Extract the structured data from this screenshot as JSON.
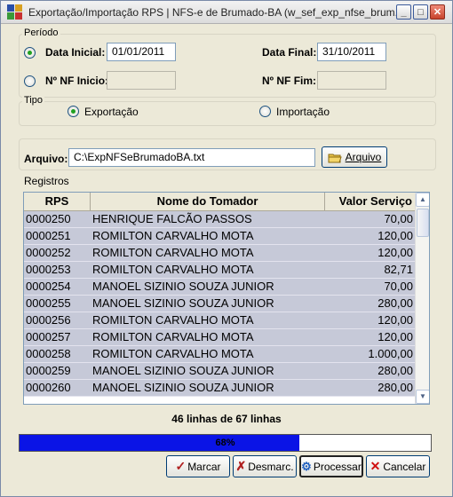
{
  "window": {
    "title": "Exportação/Importação RPS  |  NFS-e de Brumado-BA (w_sef_exp_nfse_brum...",
    "buttons": {
      "minimize": "_",
      "maximize": "□",
      "close": "✕"
    }
  },
  "periodo": {
    "legend": "Período",
    "data_inicial_label": "Data Inicial:",
    "data_inicial_value": "01/01/2011",
    "data_final_label": "Data Final:",
    "data_final_value": "31/10/2011",
    "nf_inicio_label": "Nº NF Inicio:",
    "nf_inicio_value": "",
    "nf_fim_label": "Nº NF Fim:",
    "nf_fim_value": ""
  },
  "tipo": {
    "legend": "Tipo",
    "exportacao_label": "Exportação",
    "importacao_label": "Importação",
    "selected": "Exportação"
  },
  "arquivo": {
    "label": "Arquivo:",
    "value": "C:\\ExpNFSeBrumadoBA.txt",
    "button_label": "Arquivo"
  },
  "registros": {
    "label": "Registros",
    "columns": [
      "RPS",
      "Nome do Tomador",
      "Valor Serviço"
    ],
    "rows": [
      [
        "0000250",
        "HENRIQUE FALCÃO PASSOS",
        "70,00"
      ],
      [
        "0000251",
        "ROMILTON CARVALHO MOTA",
        "120,00"
      ],
      [
        "0000252",
        "ROMILTON CARVALHO MOTA",
        "120,00"
      ],
      [
        "0000253",
        "ROMILTON CARVALHO MOTA",
        "82,71"
      ],
      [
        "0000254",
        "MANOEL SIZINIO SOUZA JUNIOR",
        "70,00"
      ],
      [
        "0000255",
        "MANOEL SIZINIO SOUZA JUNIOR",
        "280,00"
      ],
      [
        "0000256",
        "ROMILTON CARVALHO MOTA",
        "120,00"
      ],
      [
        "0000257",
        "ROMILTON CARVALHO MOTA",
        "120,00"
      ],
      [
        "0000258",
        "ROMILTON CARVALHO MOTA",
        "1.000,00"
      ],
      [
        "0000259",
        "MANOEL SIZINIO SOUZA JUNIOR",
        "280,00"
      ],
      [
        "0000260",
        "MANOEL SIZINIO SOUZA JUNIOR",
        "280,00"
      ]
    ],
    "status": "46 linhas de 67 linhas"
  },
  "progress": {
    "text": "68%",
    "fraction": 0.68,
    "color": "#0a14e6"
  },
  "buttons": {
    "marcar": "Marcar",
    "desmarcar": "Desmarc.",
    "processar": "Processar",
    "cancelar": "Cancelar"
  }
}
